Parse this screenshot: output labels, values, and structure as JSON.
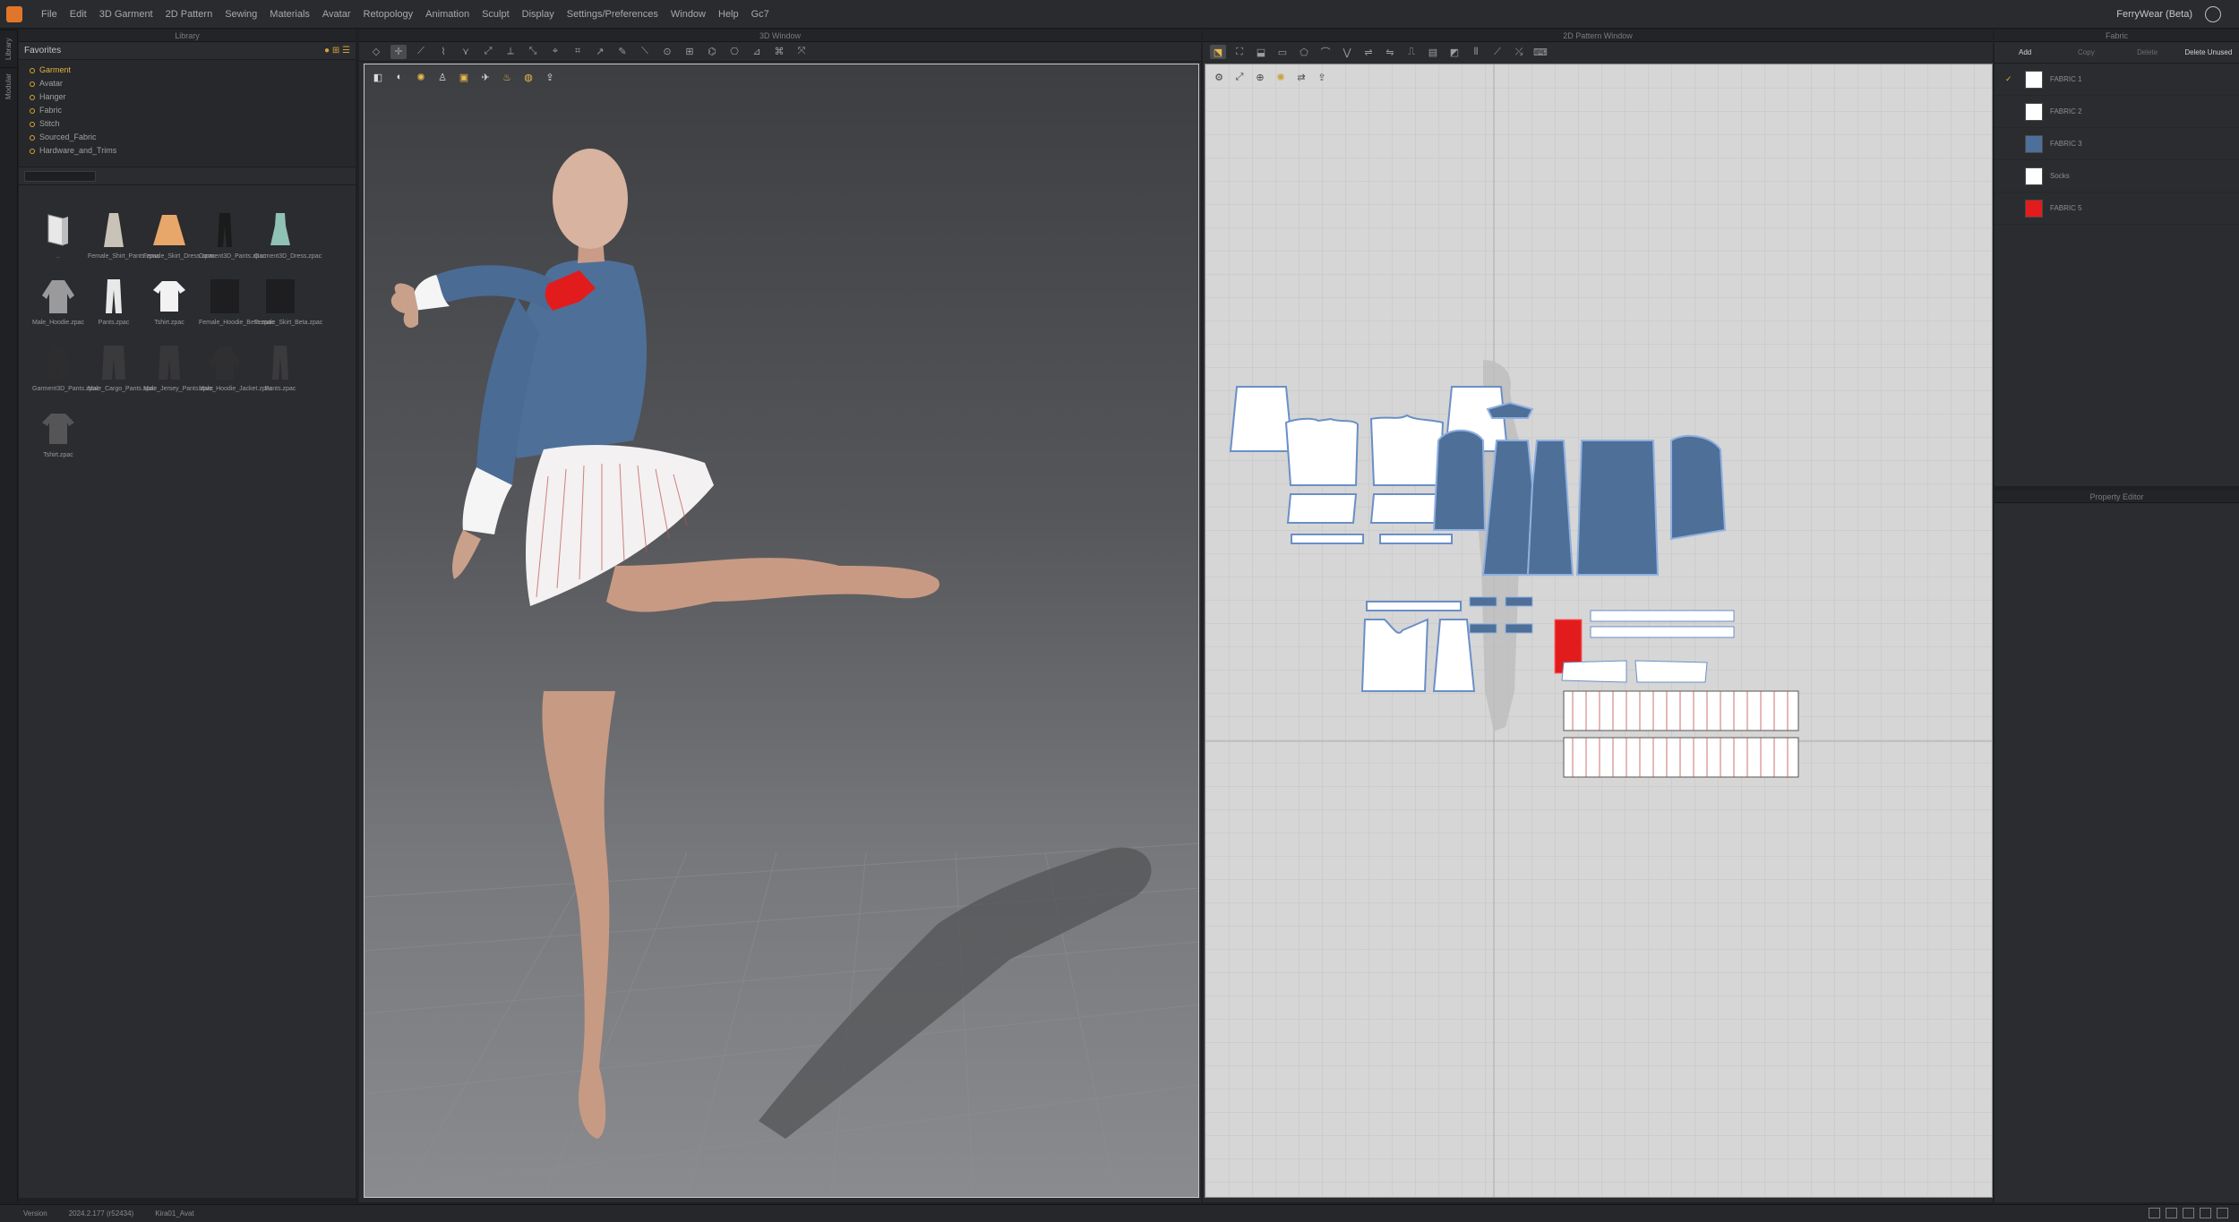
{
  "menu": {
    "items": [
      "File",
      "Edit",
      "3D Garment",
      "2D Pattern",
      "Sewing",
      "Materials",
      "Avatar",
      "Retopology",
      "Animation",
      "Sculpt",
      "Display",
      "Settings/Preferences",
      "Window",
      "Help",
      "Gc7"
    ],
    "user": "FerryWear (Beta)"
  },
  "side_tabs": [
    "Library",
    "Modular Config"
  ],
  "library": {
    "title": "Library",
    "favorites_label": "Favorites",
    "tree": [
      "Garment",
      "Avatar",
      "Hanger",
      "Fabric",
      "Stitch",
      "Sourced_Fabric",
      "Hardware_and_Trims"
    ],
    "items": [
      {
        "label": "..",
        "icon": "folder-up-icon"
      },
      {
        "label": "Female_Shirt_Pants.zpac",
        "icon": "garment-thumbnail"
      },
      {
        "label": "Female_Skirt_Dress.zpac",
        "icon": "garment-thumbnail"
      },
      {
        "label": "Garment3D_Pants.zpac",
        "icon": "garment-thumbnail"
      },
      {
        "label": "Garment3D_Dress.zpac",
        "icon": "garment-thumbnail"
      },
      {
        "label": "Male_Hoodie.zpac",
        "icon": "garment-thumbnail"
      },
      {
        "label": "Pants.zpac",
        "icon": "garment-thumbnail"
      },
      {
        "label": "Tshirt.zpac",
        "icon": "garment-thumbnail"
      },
      {
        "label": "Female_Hoodie_Beta.zpac",
        "icon": "garment-thumbnail"
      },
      {
        "label": "Female_Skirt_Beta.zpac",
        "icon": "garment-thumbnail"
      },
      {
        "label": "Garment3D_Pants.zpac",
        "icon": "garment-thumbnail"
      },
      {
        "label": "Male_Cargo_Pants.zpac",
        "icon": "garment-thumbnail"
      },
      {
        "label": "Male_Jersey_Pants.zpac",
        "icon": "garment-thumbnail"
      },
      {
        "label": "Male_Hoodie_Jacket.zpac",
        "icon": "garment-thumbnail"
      },
      {
        "label": "Pants.zpac",
        "icon": "garment-thumbnail"
      },
      {
        "label": "Tshirt.zpac",
        "icon": "garment-thumbnail"
      }
    ]
  },
  "win3d": {
    "title": "3D Window"
  },
  "win2d": {
    "title": "2D Pattern Window"
  },
  "fabric": {
    "title": "Fabric",
    "tabs": [
      "Add",
      "Copy",
      "Delete",
      "Delete Unused"
    ],
    "items": [
      {
        "name": "FABRIC 1",
        "color": "#ffffff",
        "checked": true
      },
      {
        "name": "FABRIC 2",
        "color": "#ffffff",
        "checked": false
      },
      {
        "name": "FABRIC 3",
        "color": "#4e6f98",
        "checked": false
      },
      {
        "name": "Socks",
        "color": "#ffffff",
        "checked": false
      },
      {
        "name": "FABRIC 5",
        "color": "#e21c1c",
        "checked": false
      }
    ]
  },
  "property_editor": {
    "title": "Property Editor"
  },
  "status": {
    "version_label": "Version",
    "version": "2024.2.177 (r52434)",
    "file": "Kira01_Avat"
  },
  "colors": {
    "accent": "#e0762a",
    "jacket": "#4e6f98",
    "bow": "#e21c1c",
    "pattern_outline": "#6a8fc7"
  }
}
